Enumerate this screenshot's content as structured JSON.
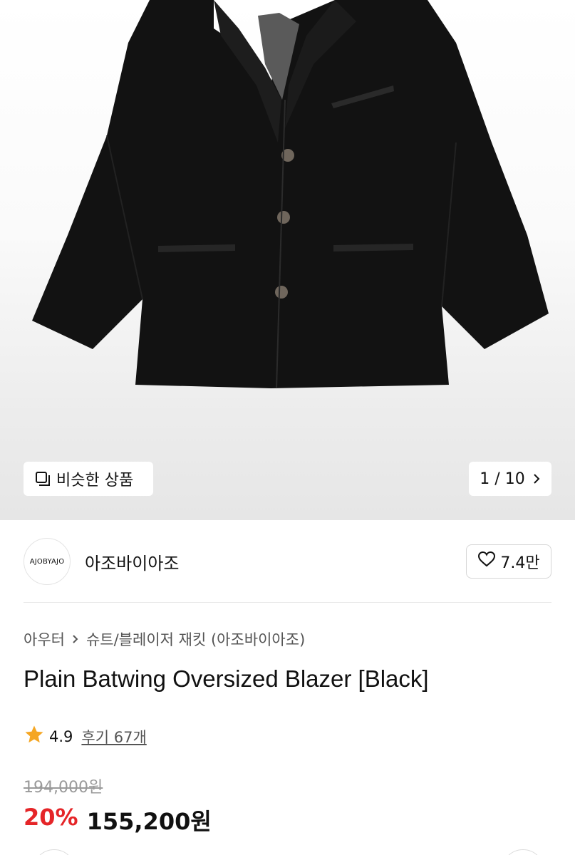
{
  "hero": {
    "similar_label": "비슷한 상품",
    "counter": "1 / 10",
    "image_subject": "black oversized blazer"
  },
  "shop": {
    "logo_text": "AJOBYAJO",
    "name": "아조바이아조",
    "likes": "7.4만"
  },
  "breadcrumb": {
    "category": "아우터",
    "subcategory": "슈트/블레이저 재킷 (아조바이아조)"
  },
  "product": {
    "title": "Plain Batwing Oversized Blazer [Black]",
    "rating": "4.9",
    "reviews": "후기 67개",
    "original_price": "194,000원",
    "discount": "20%",
    "sale_price": "155,200원"
  },
  "colors": {
    "accent_red": "#e52528",
    "star": "#f5a623",
    "text": "#111111",
    "muted": "#9a9a9a"
  }
}
